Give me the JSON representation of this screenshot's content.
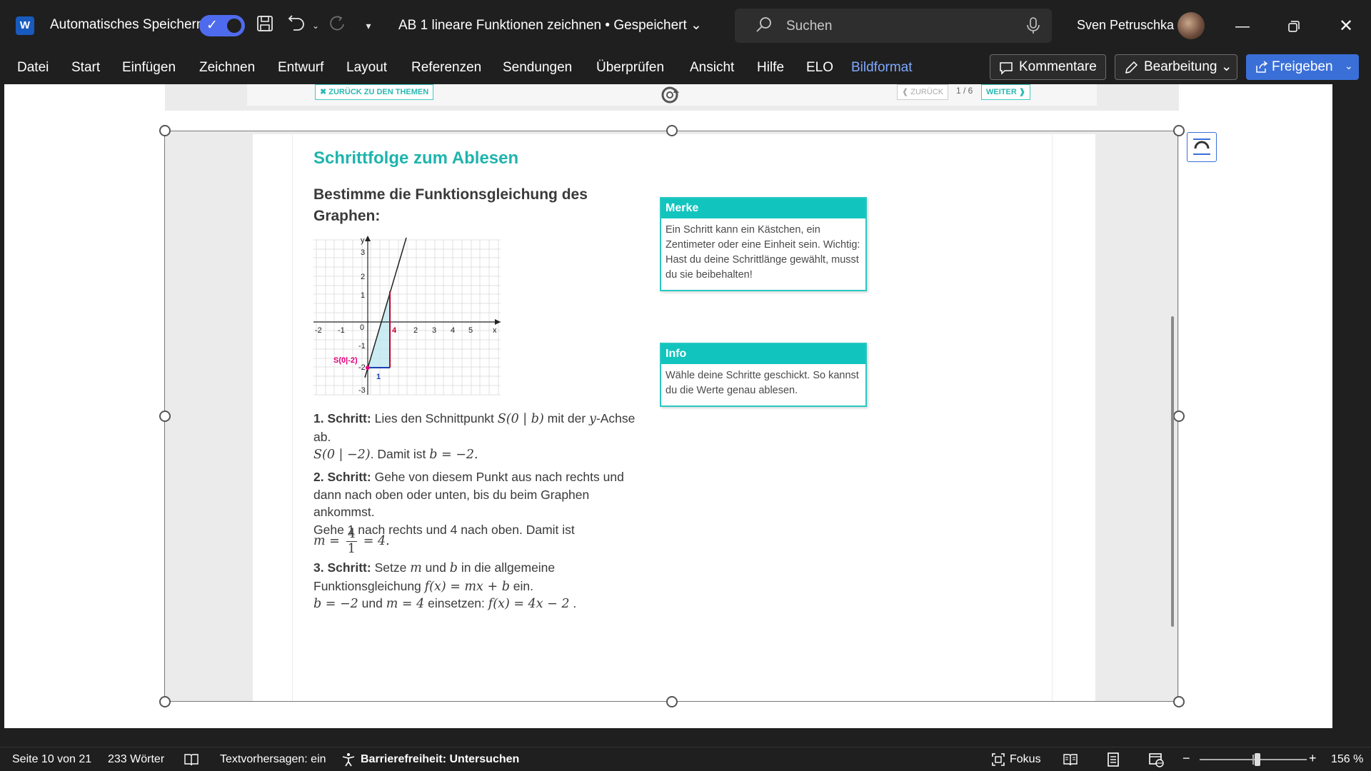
{
  "titlebar": {
    "app_letter": "W",
    "autosave_label": "Automatisches Speichern",
    "doc_title": "AB 1 lineare Funktionen zeichnen • Gespeichert ⌄",
    "search_placeholder": "Suchen",
    "user_name": "Sven Petruschka"
  },
  "menu": {
    "items": [
      "Datei",
      "Start",
      "Einfügen",
      "Zeichnen",
      "Entwurf",
      "Layout",
      "Referenzen",
      "Sendungen",
      "Überprüfen",
      "Ansicht",
      "Hilfe",
      "ELO",
      "Bildformat"
    ],
    "active": "Bildformat",
    "comments_label": "Kommentare",
    "editing_label": "Bearbeitung ⌄",
    "share_label": "Freigeben",
    "share_chevron": "⌄"
  },
  "embedded_nav": {
    "back_topics": "✖ ZURÜCK ZU DEN THEMEN",
    "prev": "❰ ZURÜCK",
    "count": "1 / 6",
    "next": "WEITER ❱"
  },
  "content": {
    "title": "Schrittfolge zum Ablesen",
    "task": "Bestimme die Funktionsgleichung des Graphen:",
    "graph": {
      "x_ticks": [
        "-2",
        "-1",
        "0",
        "4",
        "2",
        "3",
        "4",
        "5",
        "x"
      ],
      "y_ticks": [
        "y",
        "3",
        "2",
        "1",
        "-1",
        "-2",
        "-3"
      ],
      "point_label": "S(0|-2)",
      "run_label": "1",
      "rise_label": "4"
    },
    "step1_bold": "1. Schritt:",
    "step1_text": " Lies den Schnittpunkt ",
    "step1_math": "S(0 | b)",
    "step1_text2": " mit der ",
    "step1_math2": "y",
    "step1_text3": "-Achse ab.",
    "step1b_math": "S(0 | −2)",
    "step1b_text": ". Damit ist ",
    "step1b_math2": "b = −2.",
    "step2_bold": "2. Schritt:",
    "step2_text": " Gehe von diesem Punkt aus nach rechts und dann nach oben oder unten, bis du beim Graphen ankommst.",
    "step2_line2": "Gehe 1 nach rechts und 4 nach oben. Damit ist",
    "step2_m": "m =",
    "step2_num": "4",
    "step2_den": "1",
    "step2_res": "= 4.",
    "step3_bold": "3. Schritt:",
    "step3_text": " Setze ",
    "step3_m": "m",
    "step3_und": " und ",
    "step3_b": "b",
    "step3_text2": " in die allgemeine Funktionsgleichung ",
    "step3_f": "f(x) = mx + b",
    "step3_ein": " ein.",
    "step4_b": "b = −2",
    "step4_und": " und ",
    "step4_m": "m = 4",
    "step4_text": " einsetzen: ",
    "step4_f": "f(x) = 4x − 2",
    "step4_end": " ."
  },
  "merke": {
    "header": "Merke",
    "body": "Ein Schritt kann ein Kästchen, ein Zentimeter oder eine Einheit sein. Wichtig: Hast du deine Schrittlänge gewählt, musst du sie beibehalten!"
  },
  "info": {
    "header": "Info",
    "body": "Wähle deine Schritte geschickt. So kannst du die Werte genau ablesen."
  },
  "statusbar": {
    "page": "Seite 10 von 21",
    "words": "233 Wörter",
    "predictions": "Textvorhersagen: ein",
    "accessibility": "Barrierefreiheit: Untersuchen",
    "focus": "Fokus",
    "zoom": "156 %"
  },
  "colors": {
    "accent": "#1eb4ad",
    "word_blue": "#185abd",
    "share_blue": "#3a6fd8"
  }
}
